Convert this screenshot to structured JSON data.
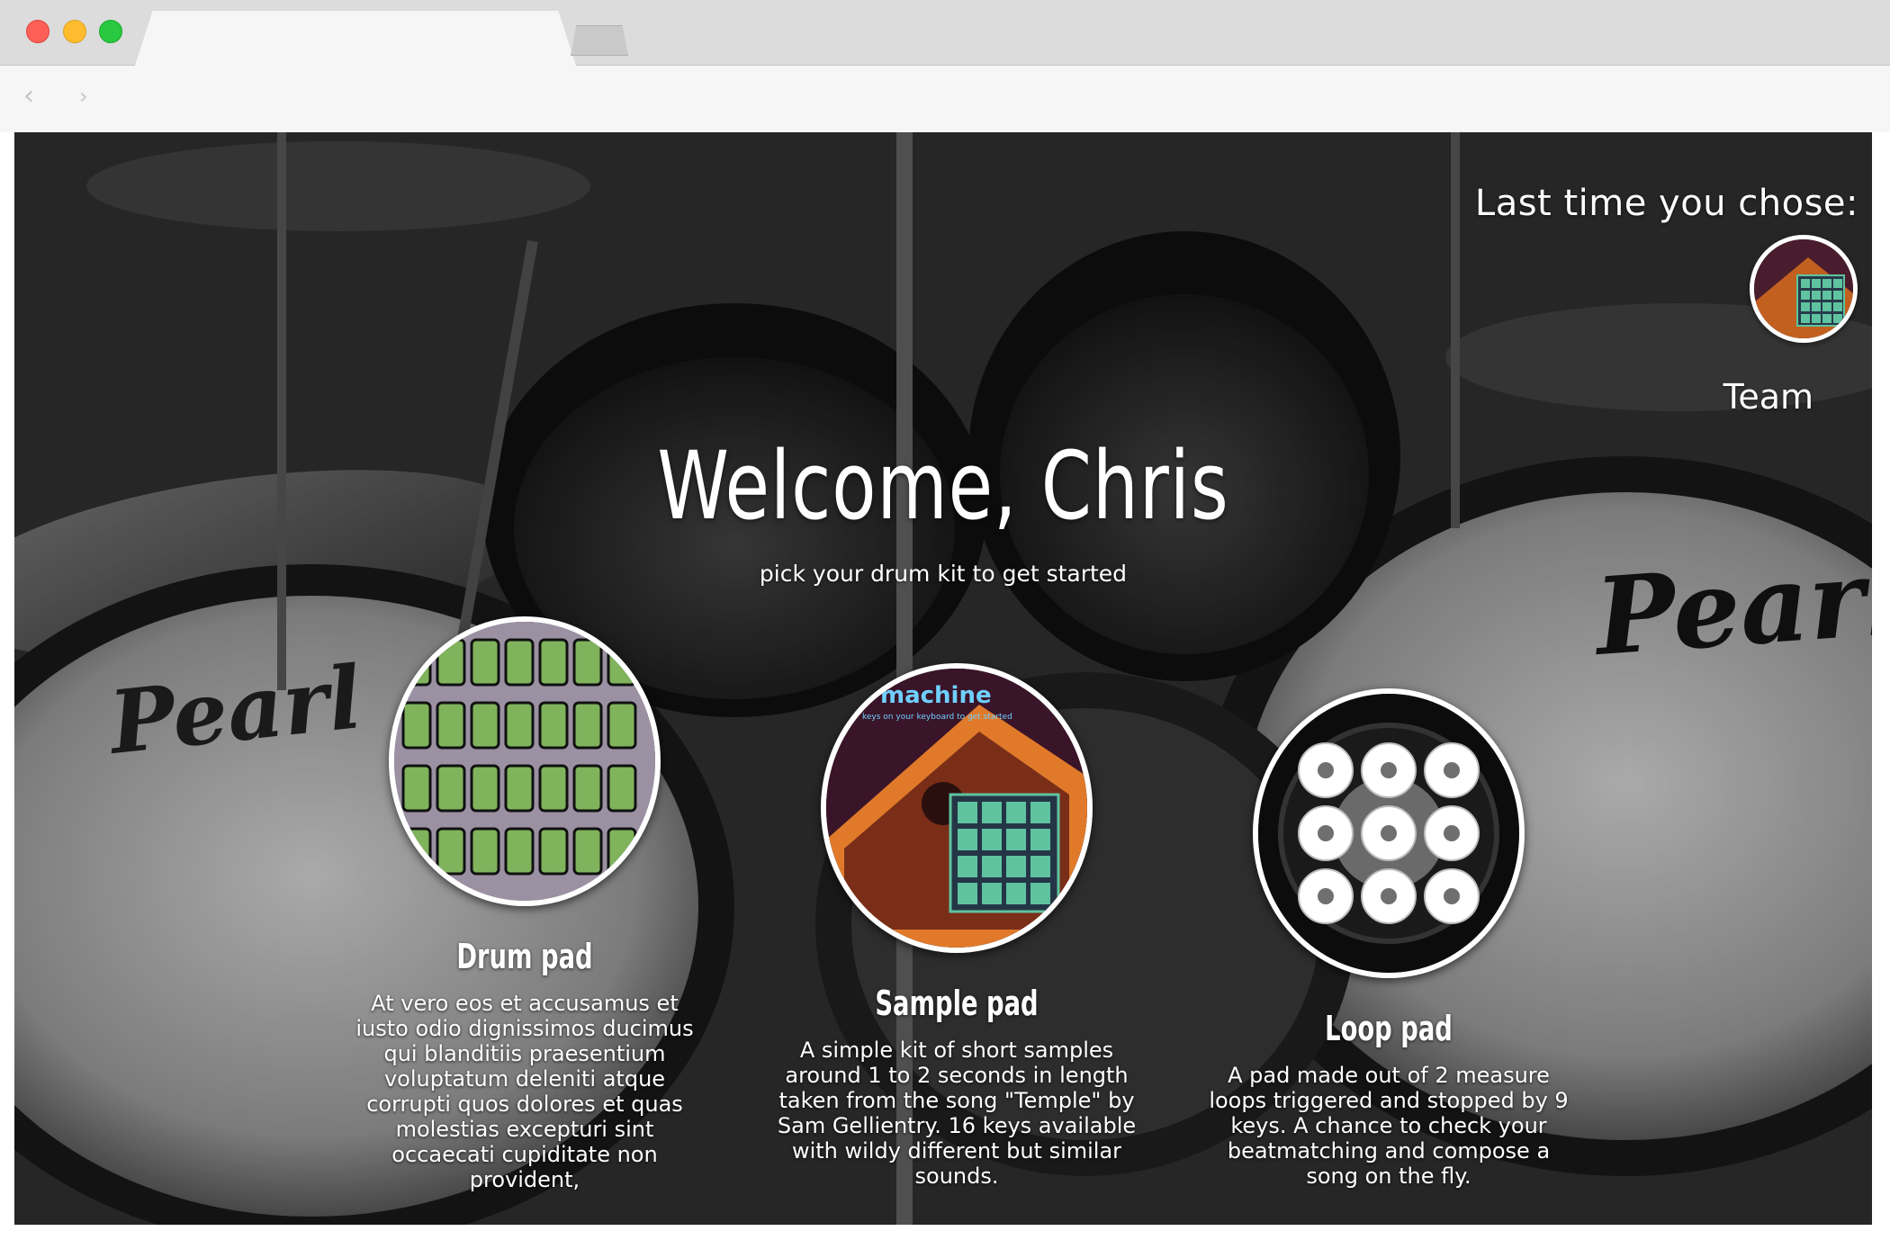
{
  "header": {
    "last_choice_label": "Last time you chose:",
    "team_link": "Team"
  },
  "hero": {
    "welcome": "Welcome, Chris",
    "subtitle": "pick your drum kit to get started"
  },
  "kits": [
    {
      "title": "Drum pad",
      "description": "At vero eos et accusamus et iusto odio dignissimos ducimus qui blanditiis praesentium voluptatum deleniti atque corrupti quos dolores et quas molestias excepturi sint occaecati cupiditate non provident,"
    },
    {
      "title": "Sample pad",
      "description": "A simple kit of short samples around 1 to 2 seconds in length taken from the song \"Temple\" by Sam Gellientry. 16 keys available with wildy different but similar sounds."
    },
    {
      "title": "Loop pad",
      "description": "A pad made out of 2 measure loops triggered and stopped by 9 keys. A chance to check your beatmatching and compose a song on the fly."
    }
  ],
  "background": {
    "brand_logo": "Pearl"
  },
  "sample_image": {
    "caption": "machine",
    "subcaption": "keys on your keyboard to get started"
  },
  "colors": {
    "traffic_red": "#fe5f57",
    "traffic_yellow": "#febc2e",
    "traffic_green": "#28c840",
    "pad_green": "#7fb35c",
    "sample_pad_teal": "#5fc3a0",
    "sample_orange": "#e07a2a",
    "text": "#ffffff"
  }
}
